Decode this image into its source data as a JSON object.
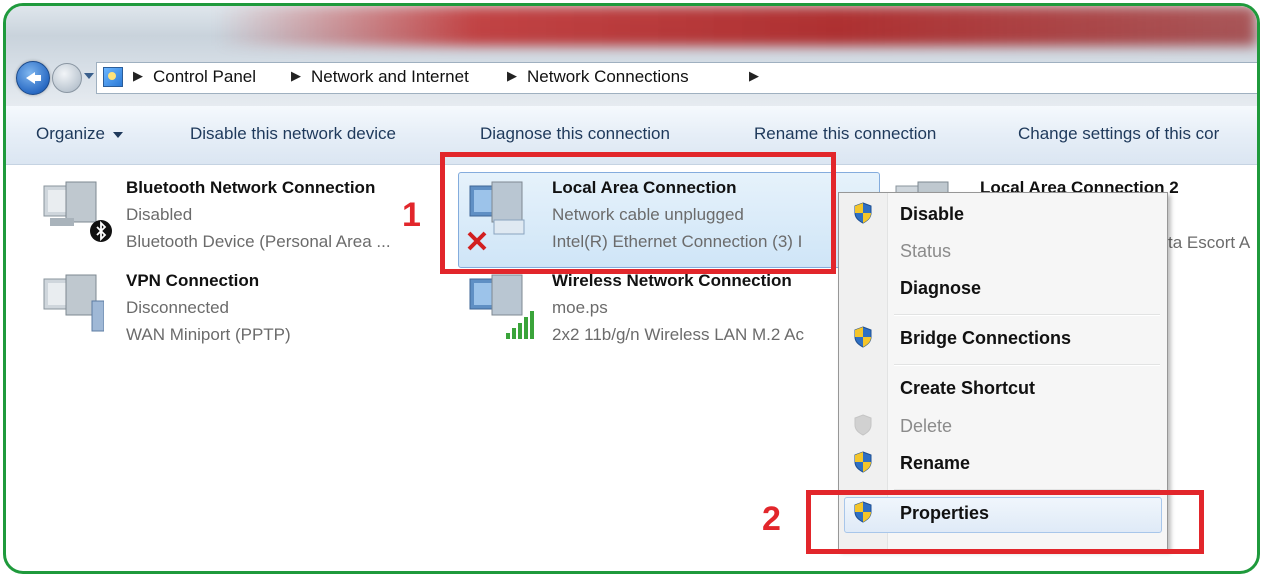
{
  "breadcrumb": {
    "items": [
      "Control Panel",
      "Network and Internet",
      "Network Connections"
    ]
  },
  "toolbar": {
    "organize": "Organize",
    "disable": "Disable this network device",
    "diagnose": "Diagnose this connection",
    "rename": "Rename this connection",
    "change": "Change settings of this cor"
  },
  "connections": [
    {
      "name": "Bluetooth Network Connection",
      "status": "Disabled",
      "device": "Bluetooth Device (Personal Area ..."
    },
    {
      "name": "VPN Connection",
      "status": "Disconnected",
      "device": "WAN Miniport (PPTP)"
    },
    {
      "name": "Local Area Connection",
      "status": "Network cable unplugged",
      "device": "Intel(R) Ethernet Connection (3) I"
    },
    {
      "name": "Wireless Network Connection",
      "status": "moe.ps",
      "device": "2x2 11b/g/n Wireless LAN M.2 Ac"
    },
    {
      "name": "Local Area Connection 2",
      "status": "",
      "device": "ta Escort A"
    }
  ],
  "annotations": {
    "one": "1",
    "two": "2"
  },
  "context_menu": {
    "items": [
      "Disable",
      "Status",
      "Diagnose",
      "Bridge Connections",
      "Create Shortcut",
      "Delete",
      "Rename",
      "Properties"
    ]
  },
  "colors": {
    "frame": "#1f9a3c",
    "annotation": "#e2262b",
    "selection": "#cfe5f7"
  }
}
